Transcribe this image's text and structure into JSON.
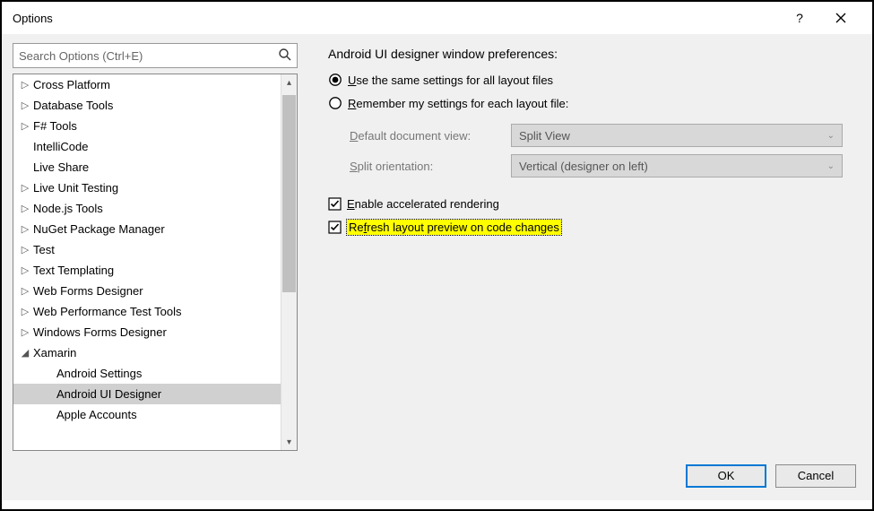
{
  "window": {
    "title": "Options"
  },
  "search": {
    "placeholder": "Search Options (Ctrl+E)"
  },
  "tree": {
    "items": [
      {
        "label": "Cross Platform",
        "level": 1,
        "glyph": "▷",
        "selected": false
      },
      {
        "label": "Database Tools",
        "level": 1,
        "glyph": "▷",
        "selected": false
      },
      {
        "label": "F# Tools",
        "level": 1,
        "glyph": "▷",
        "selected": false
      },
      {
        "label": "IntelliCode",
        "level": 1,
        "glyph": "",
        "selected": false
      },
      {
        "label": "Live Share",
        "level": 1,
        "glyph": "",
        "selected": false
      },
      {
        "label": "Live Unit Testing",
        "level": 1,
        "glyph": "▷",
        "selected": false
      },
      {
        "label": "Node.js Tools",
        "level": 1,
        "glyph": "▷",
        "selected": false
      },
      {
        "label": "NuGet Package Manager",
        "level": 1,
        "glyph": "▷",
        "selected": false
      },
      {
        "label": "Test",
        "level": 1,
        "glyph": "▷",
        "selected": false
      },
      {
        "label": "Text Templating",
        "level": 1,
        "glyph": "▷",
        "selected": false
      },
      {
        "label": "Web Forms Designer",
        "level": 1,
        "glyph": "▷",
        "selected": false
      },
      {
        "label": "Web Performance Test Tools",
        "level": 1,
        "glyph": "▷",
        "selected": false
      },
      {
        "label": "Windows Forms Designer",
        "level": 1,
        "glyph": "▷",
        "selected": false
      },
      {
        "label": "Xamarin",
        "level": 1,
        "glyph": "◢",
        "selected": false
      },
      {
        "label": "Android Settings",
        "level": 2,
        "glyph": "",
        "selected": false
      },
      {
        "label": "Android UI Designer",
        "level": 2,
        "glyph": "",
        "selected": true
      },
      {
        "label": "Apple Accounts",
        "level": 2,
        "glyph": "",
        "selected": false
      }
    ]
  },
  "detail": {
    "heading": "Android UI designer window preferences:",
    "radio1": {
      "u": "U",
      "rest": "se the same settings for all layout files",
      "checked": true
    },
    "radio2": {
      "u": "R",
      "rest": "emember my settings for each layout file:",
      "checked": false
    },
    "docview_label": {
      "u": "D",
      "rest": "efault document view:"
    },
    "docview_value": "Split View",
    "splitorient_label": {
      "u": "S",
      "rest": "plit orientation:"
    },
    "splitorient_value": "Vertical (designer on left)",
    "check1": {
      "u": "E",
      "rest": "nable accelerated rendering",
      "checked": true
    },
    "check2": {
      "pre": "Re",
      "u": "f",
      "rest": "resh layout preview on code changes",
      "checked": true
    }
  },
  "footer": {
    "ok": "OK",
    "cancel": "Cancel"
  }
}
